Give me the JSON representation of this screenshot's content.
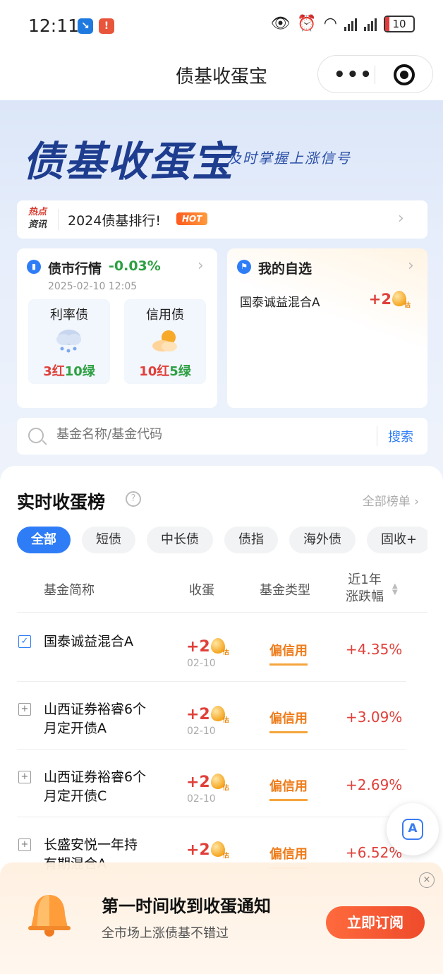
{
  "status_bar": {
    "time": "12:11",
    "battery": "10"
  },
  "nav": {
    "title": "债基收蛋宝"
  },
  "hero": {
    "brand": "债基收蛋宝",
    "slogan": "及时掌握上涨信号"
  },
  "hot": {
    "tag_line1": "热点",
    "tag_line2": "资讯",
    "text": "2024债基排行!",
    "badge": "HOT"
  },
  "market": {
    "title": "债市行情",
    "change": "-0.03%",
    "time": "2025-02-10 12:05",
    "items": [
      {
        "label": "利率债",
        "red": "3红",
        "green": "10绿",
        "weather": "rain-cloud-icon"
      },
      {
        "label": "信用债",
        "red": "10红",
        "green": "5绿",
        "weather": "partly-sunny-icon"
      }
    ]
  },
  "favorite": {
    "title": "我的自选",
    "item": "国泰诚益混合A",
    "value": "+2",
    "egg_note": "估"
  },
  "search": {
    "placeholder": "基金名称/基金代码",
    "button": "搜索"
  },
  "ranking": {
    "title": "实时收蛋榜",
    "all_link": "全部榜单",
    "filters": [
      "全部",
      "短债",
      "中长债",
      "债指",
      "海外债",
      "固收+"
    ],
    "headers": {
      "name": "基金简称",
      "eggs": "收蛋",
      "type": "基金类型",
      "change_line1": "近1年",
      "change_line2": "涨跌幅"
    },
    "rows": [
      {
        "name": "国泰诚益混合A",
        "eggs": "+2",
        "egg_note": "估",
        "date": "02-10",
        "type": "偏信用",
        "change": "+4.35%",
        "selected": true
      },
      {
        "name": "山西证券裕睿6个月定开债A",
        "eggs": "+2",
        "egg_note": "估",
        "date": "02-10",
        "type": "偏信用",
        "change": "+3.09%",
        "selected": false
      },
      {
        "name": "山西证券裕睿6个月定开债C",
        "eggs": "+2",
        "egg_note": "估",
        "date": "02-10",
        "type": "偏信用",
        "change": "+2.69%",
        "selected": false
      },
      {
        "name": "长盛安悦一年持有期混合A",
        "eggs": "+2",
        "egg_note": "估",
        "date": "",
        "type": "偏信用",
        "change": "+6.52%",
        "selected": false
      }
    ]
  },
  "notification": {
    "title": "第一时间收到收蛋通知",
    "subtitle": "全市场上涨债基不错过",
    "button": "立即订阅"
  },
  "colors": {
    "accent": "#2f7df6",
    "up": "#e0403a",
    "down": "#2ea043",
    "type_tag": "#ee7c1a",
    "cta": "#ee4b2b"
  }
}
